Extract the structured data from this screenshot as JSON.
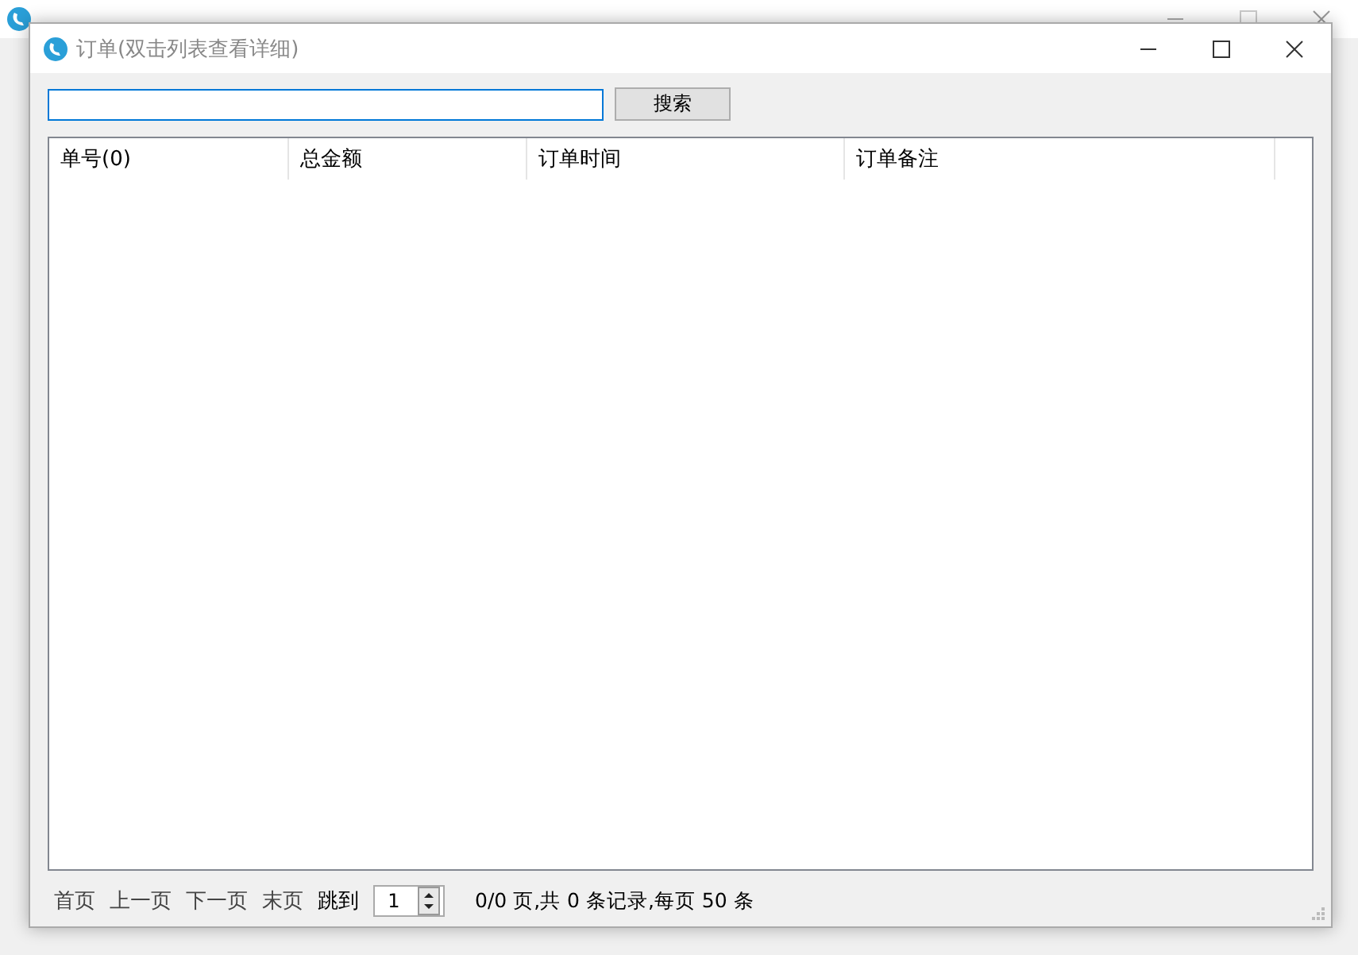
{
  "window": {
    "title": "订单(双击列表查看详细)"
  },
  "search": {
    "button": "搜索"
  },
  "table": {
    "columns": [
      "单号(0)",
      "总金额",
      "订单时间",
      "订单备注"
    ]
  },
  "pager": {
    "links": [
      "首页",
      "上一页",
      "下一页",
      "末页"
    ],
    "jump_label": "跳到",
    "page_value": "1",
    "summary": "0/0 页,共 0 条记录,每页 50 条"
  }
}
